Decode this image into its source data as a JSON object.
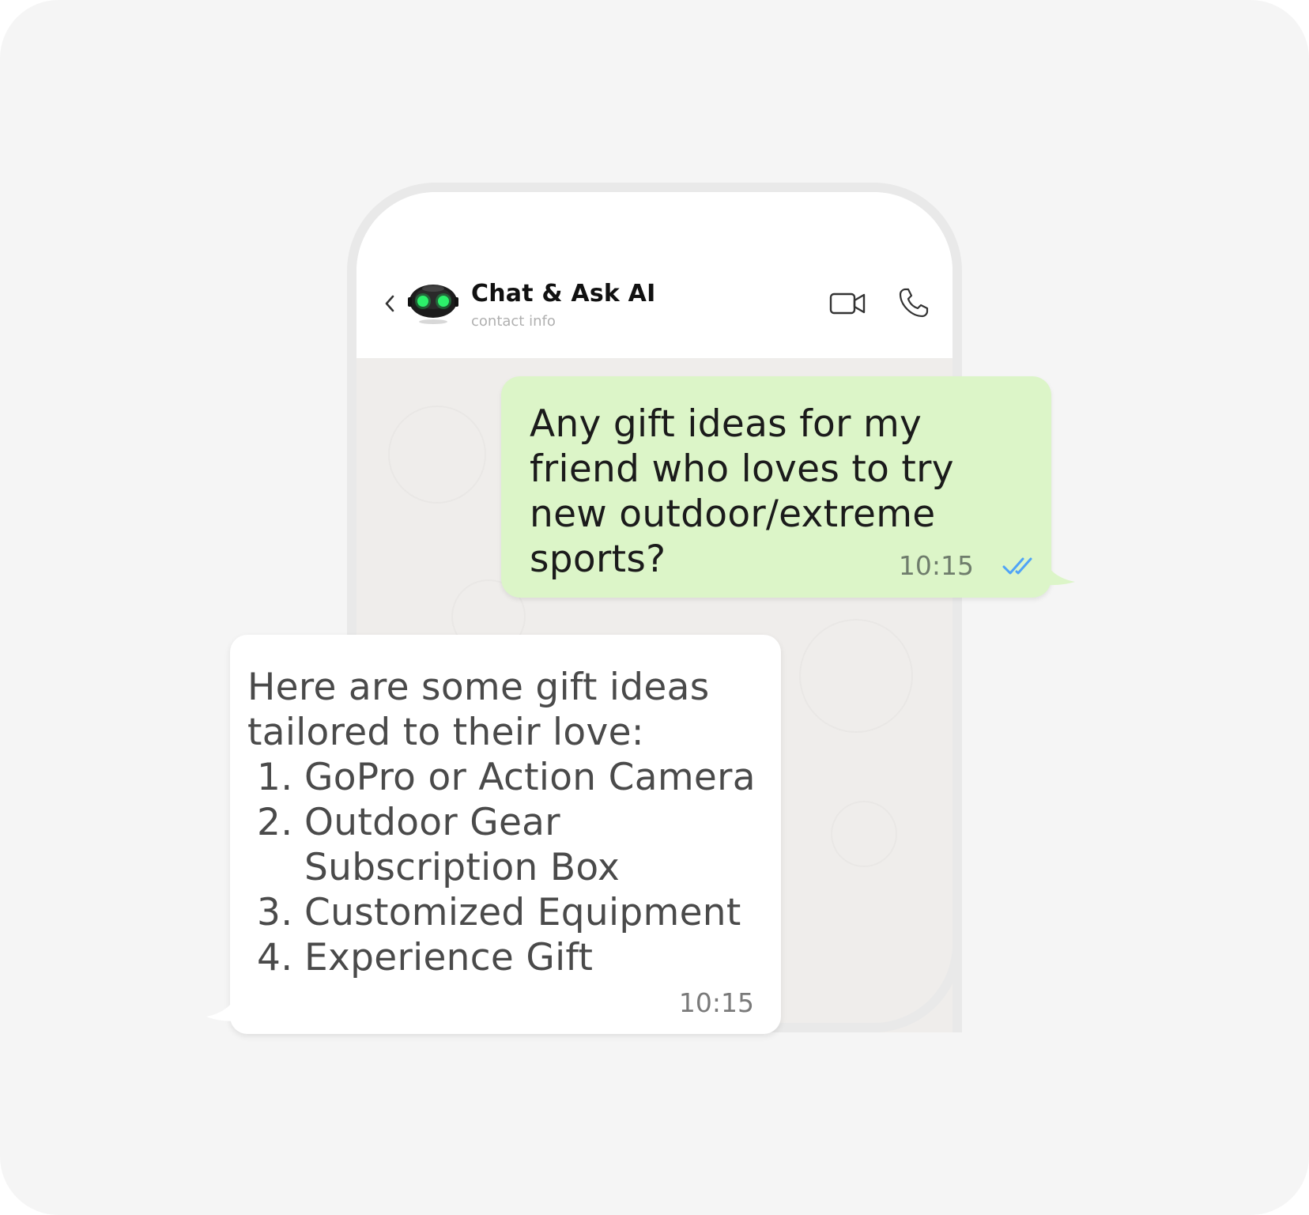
{
  "header": {
    "contact_name": "Chat & Ask AI",
    "contact_subtitle": "contact info",
    "back_icon": "chevron-left-icon",
    "video_icon": "video-camera-icon",
    "call_icon": "phone-icon"
  },
  "messages": [
    {
      "direction": "outgoing",
      "text": "Any gift ideas for my friend who loves to try new outdoor/extreme sports?",
      "time": "10:15",
      "status": "read",
      "status_icon": "double-check-icon"
    },
    {
      "direction": "incoming",
      "intro": "Here are some gift ideas tailored to their love:",
      "items": [
        {
          "num": "1.",
          "text": "GoPro or Action Camera"
        },
        {
          "num": "2.",
          "text": "Outdoor Gear Subscription Box"
        },
        {
          "num": "3.",
          "text": "Customized Equipment"
        },
        {
          "num": "4.",
          "text": "Experience Gift"
        }
      ],
      "time": "10:15"
    }
  ],
  "colors": {
    "outgoing_bubble": "#dcf5c8",
    "incoming_bubble": "#ffffff",
    "read_ticks": "#4fa3f7",
    "avatar_eyes": "#2cf06a",
    "background": "#f5f5f5"
  }
}
